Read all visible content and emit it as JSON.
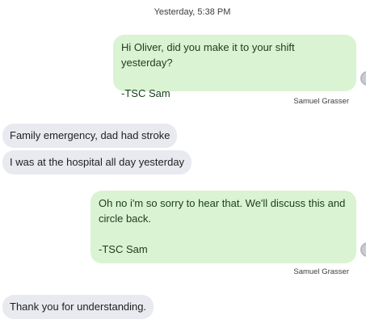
{
  "thread": {
    "timestamp": "Yesterday, 5:38 PM",
    "messages": [
      {
        "direction": "outgoing",
        "text": "Hi Oliver, did you make it to your shift yesterday?\n\n-TSC Sam",
        "sender": "Samuel Grasser"
      },
      {
        "direction": "incoming",
        "text": "Family emergency, dad had stroke"
      },
      {
        "direction": "incoming",
        "text": "I was at the hospital all day yesterday"
      },
      {
        "direction": "outgoing",
        "text": "Oh no i'm so sorry to hear that. We'll discuss this and\ncircle back.\n\n-TSC Sam",
        "sender": "Samuel Grasser"
      },
      {
        "direction": "incoming",
        "text": "Thank you for understanding."
      }
    ]
  },
  "colors": {
    "outgoing_bubble": "#daf3d3",
    "incoming_bubble": "#e8eaf0"
  }
}
